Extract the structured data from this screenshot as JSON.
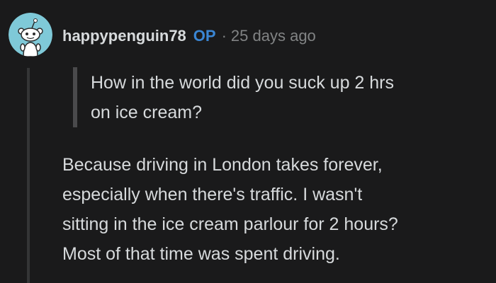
{
  "comment": {
    "author": "happypenguin78",
    "op_badge": "OP",
    "separator": "·",
    "timestamp": "25 days ago",
    "quote_lines": [
      "How in the world did you suck up 2 hrs",
      "on ice cream?"
    ],
    "body_lines": [
      "Because driving in London takes forever,",
      "especially when there's traffic. I wasn't",
      "sitting in the ice cream parlour for 2 hours?",
      "Most of that time was spent driving."
    ]
  },
  "colors": {
    "background": "#1a1a1b",
    "text": "#d7dadc",
    "op_badge": "#3a86d4",
    "muted": "#818384",
    "avatar_bg": "#7fc9d8"
  },
  "icons": {
    "avatar": "snoo-avatar-icon"
  }
}
